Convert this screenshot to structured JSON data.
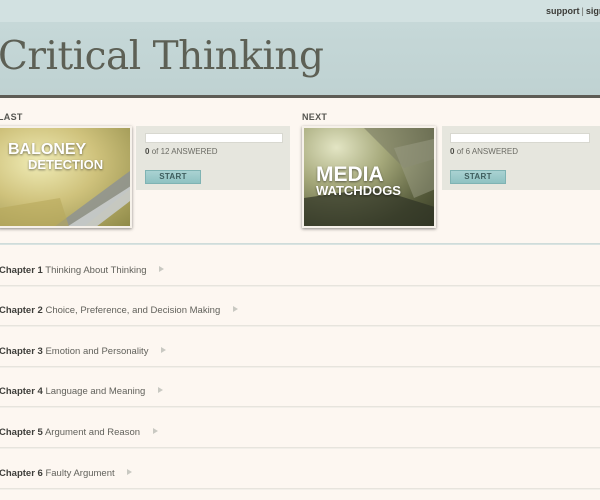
{
  "top_links": {
    "support": "support",
    "separator": "|",
    "sign": "sign"
  },
  "header": {
    "title": "Critical Thinking"
  },
  "quizzes": {
    "last": {
      "label": "LAST",
      "thumb_line1": "BALONEY",
      "thumb_line2": "DETECTION",
      "answered_count": "0",
      "answered_of": "of 12",
      "answered_word": "ANSWERED",
      "start_label": "START",
      "progress": 0
    },
    "next": {
      "label": "NEXT",
      "thumb_line1": "MEDIA",
      "thumb_line2": "WATCHDOGS",
      "answered_count": "0",
      "answered_of": "of 6",
      "answered_word": "ANSWERED",
      "start_label": "START",
      "progress": 0
    }
  },
  "chapters": [
    {
      "num": "Chapter 1",
      "name": "Thinking About Thinking"
    },
    {
      "num": "Chapter 2",
      "name": "Choice, Preference, and Decision Making"
    },
    {
      "num": "Chapter 3",
      "name": "Emotion and Personality"
    },
    {
      "num": "Chapter 4",
      "name": "Language and Meaning"
    },
    {
      "num": "Chapter 5",
      "name": "Argument and Reason"
    },
    {
      "num": "Chapter 6",
      "name": "Faulty Argument"
    }
  ],
  "colors": {
    "header_bg": "#c6d8d8",
    "page_bg": "#fdf7f1",
    "accent_button": "#9fcdcd",
    "title": "#5d6055"
  }
}
